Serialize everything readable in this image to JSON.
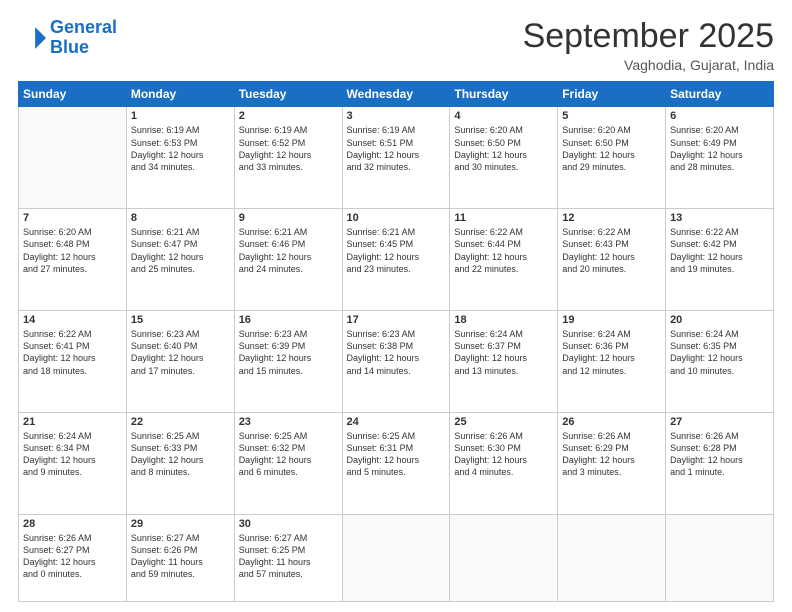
{
  "header": {
    "logo_line1": "General",
    "logo_line2": "Blue",
    "month": "September 2025",
    "location": "Vaghodia, Gujarat, India"
  },
  "days_of_week": [
    "Sunday",
    "Monday",
    "Tuesday",
    "Wednesday",
    "Thursday",
    "Friday",
    "Saturday"
  ],
  "weeks": [
    [
      {
        "day": "",
        "lines": []
      },
      {
        "day": "1",
        "lines": [
          "Sunrise: 6:19 AM",
          "Sunset: 6:53 PM",
          "Daylight: 12 hours",
          "and 34 minutes."
        ]
      },
      {
        "day": "2",
        "lines": [
          "Sunrise: 6:19 AM",
          "Sunset: 6:52 PM",
          "Daylight: 12 hours",
          "and 33 minutes."
        ]
      },
      {
        "day": "3",
        "lines": [
          "Sunrise: 6:19 AM",
          "Sunset: 6:51 PM",
          "Daylight: 12 hours",
          "and 32 minutes."
        ]
      },
      {
        "day": "4",
        "lines": [
          "Sunrise: 6:20 AM",
          "Sunset: 6:50 PM",
          "Daylight: 12 hours",
          "and 30 minutes."
        ]
      },
      {
        "day": "5",
        "lines": [
          "Sunrise: 6:20 AM",
          "Sunset: 6:50 PM",
          "Daylight: 12 hours",
          "and 29 minutes."
        ]
      },
      {
        "day": "6",
        "lines": [
          "Sunrise: 6:20 AM",
          "Sunset: 6:49 PM",
          "Daylight: 12 hours",
          "and 28 minutes."
        ]
      }
    ],
    [
      {
        "day": "7",
        "lines": [
          "Sunrise: 6:20 AM",
          "Sunset: 6:48 PM",
          "Daylight: 12 hours",
          "and 27 minutes."
        ]
      },
      {
        "day": "8",
        "lines": [
          "Sunrise: 6:21 AM",
          "Sunset: 6:47 PM",
          "Daylight: 12 hours",
          "and 25 minutes."
        ]
      },
      {
        "day": "9",
        "lines": [
          "Sunrise: 6:21 AM",
          "Sunset: 6:46 PM",
          "Daylight: 12 hours",
          "and 24 minutes."
        ]
      },
      {
        "day": "10",
        "lines": [
          "Sunrise: 6:21 AM",
          "Sunset: 6:45 PM",
          "Daylight: 12 hours",
          "and 23 minutes."
        ]
      },
      {
        "day": "11",
        "lines": [
          "Sunrise: 6:22 AM",
          "Sunset: 6:44 PM",
          "Daylight: 12 hours",
          "and 22 minutes."
        ]
      },
      {
        "day": "12",
        "lines": [
          "Sunrise: 6:22 AM",
          "Sunset: 6:43 PM",
          "Daylight: 12 hours",
          "and 20 minutes."
        ]
      },
      {
        "day": "13",
        "lines": [
          "Sunrise: 6:22 AM",
          "Sunset: 6:42 PM",
          "Daylight: 12 hours",
          "and 19 minutes."
        ]
      }
    ],
    [
      {
        "day": "14",
        "lines": [
          "Sunrise: 6:22 AM",
          "Sunset: 6:41 PM",
          "Daylight: 12 hours",
          "and 18 minutes."
        ]
      },
      {
        "day": "15",
        "lines": [
          "Sunrise: 6:23 AM",
          "Sunset: 6:40 PM",
          "Daylight: 12 hours",
          "and 17 minutes."
        ]
      },
      {
        "day": "16",
        "lines": [
          "Sunrise: 6:23 AM",
          "Sunset: 6:39 PM",
          "Daylight: 12 hours",
          "and 15 minutes."
        ]
      },
      {
        "day": "17",
        "lines": [
          "Sunrise: 6:23 AM",
          "Sunset: 6:38 PM",
          "Daylight: 12 hours",
          "and 14 minutes."
        ]
      },
      {
        "day": "18",
        "lines": [
          "Sunrise: 6:24 AM",
          "Sunset: 6:37 PM",
          "Daylight: 12 hours",
          "and 13 minutes."
        ]
      },
      {
        "day": "19",
        "lines": [
          "Sunrise: 6:24 AM",
          "Sunset: 6:36 PM",
          "Daylight: 12 hours",
          "and 12 minutes."
        ]
      },
      {
        "day": "20",
        "lines": [
          "Sunrise: 6:24 AM",
          "Sunset: 6:35 PM",
          "Daylight: 12 hours",
          "and 10 minutes."
        ]
      }
    ],
    [
      {
        "day": "21",
        "lines": [
          "Sunrise: 6:24 AM",
          "Sunset: 6:34 PM",
          "Daylight: 12 hours",
          "and 9 minutes."
        ]
      },
      {
        "day": "22",
        "lines": [
          "Sunrise: 6:25 AM",
          "Sunset: 6:33 PM",
          "Daylight: 12 hours",
          "and 8 minutes."
        ]
      },
      {
        "day": "23",
        "lines": [
          "Sunrise: 6:25 AM",
          "Sunset: 6:32 PM",
          "Daylight: 12 hours",
          "and 6 minutes."
        ]
      },
      {
        "day": "24",
        "lines": [
          "Sunrise: 6:25 AM",
          "Sunset: 6:31 PM",
          "Daylight: 12 hours",
          "and 5 minutes."
        ]
      },
      {
        "day": "25",
        "lines": [
          "Sunrise: 6:26 AM",
          "Sunset: 6:30 PM",
          "Daylight: 12 hours",
          "and 4 minutes."
        ]
      },
      {
        "day": "26",
        "lines": [
          "Sunrise: 6:26 AM",
          "Sunset: 6:29 PM",
          "Daylight: 12 hours",
          "and 3 minutes."
        ]
      },
      {
        "day": "27",
        "lines": [
          "Sunrise: 6:26 AM",
          "Sunset: 6:28 PM",
          "Daylight: 12 hours",
          "and 1 minute."
        ]
      }
    ],
    [
      {
        "day": "28",
        "lines": [
          "Sunrise: 6:26 AM",
          "Sunset: 6:27 PM",
          "Daylight: 12 hours",
          "and 0 minutes."
        ]
      },
      {
        "day": "29",
        "lines": [
          "Sunrise: 6:27 AM",
          "Sunset: 6:26 PM",
          "Daylight: 11 hours",
          "and 59 minutes."
        ]
      },
      {
        "day": "30",
        "lines": [
          "Sunrise: 6:27 AM",
          "Sunset: 6:25 PM",
          "Daylight: 11 hours",
          "and 57 minutes."
        ]
      },
      {
        "day": "",
        "lines": []
      },
      {
        "day": "",
        "lines": []
      },
      {
        "day": "",
        "lines": []
      },
      {
        "day": "",
        "lines": []
      }
    ]
  ]
}
